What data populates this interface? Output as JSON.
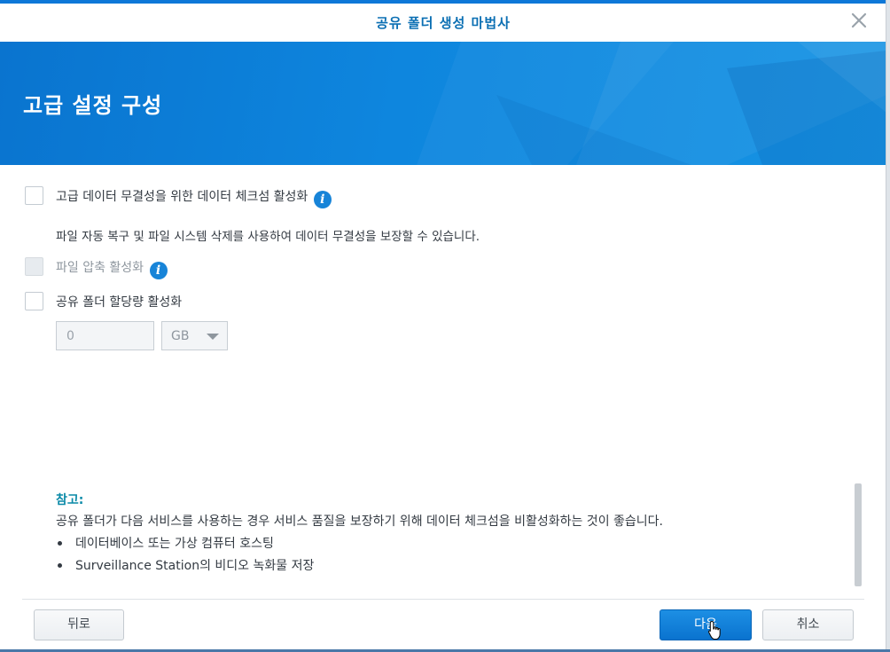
{
  "window": {
    "title": "공유 폴더 생성 마법사"
  },
  "banner": {
    "title": "고급 설정 구성"
  },
  "options": {
    "checksum": {
      "label": "고급 데이터 무결성을 위한 데이터 체크섬 활성화",
      "checked": false,
      "description": "파일 자동 복구 및 파일 시스템 삭제를 사용하여 데이터 무결성을 보장할 수 있습니다."
    },
    "compression": {
      "label": "파일 압축 활성화",
      "checked": false,
      "disabled": true
    },
    "quota": {
      "label": "공유 폴더 할당량 활성화",
      "checked": false,
      "value": "0",
      "unit": "GB"
    }
  },
  "note": {
    "title": "참고:",
    "body": "공유 폴더가 다음 서비스를 사용하는 경우 서비스 품질을 보장하기 위해 데이터 체크섬을 비활성화하는 것이 좋습니다.",
    "items": [
      "데이터베이스 또는 가상 컴퓨터 호스팅",
      "Surveillance Station의 비디오 녹화물 저장"
    ]
  },
  "footer": {
    "back_label": "뒤로",
    "next_label": "다음",
    "cancel_label": "취소"
  },
  "colors": {
    "accent": "#0d78d8",
    "title_text": "#0b6fb3",
    "note_title": "#0b8aa8"
  },
  "icons": [
    "close-icon",
    "info-icon",
    "chevron-down-icon",
    "hand-cursor-icon"
  ]
}
